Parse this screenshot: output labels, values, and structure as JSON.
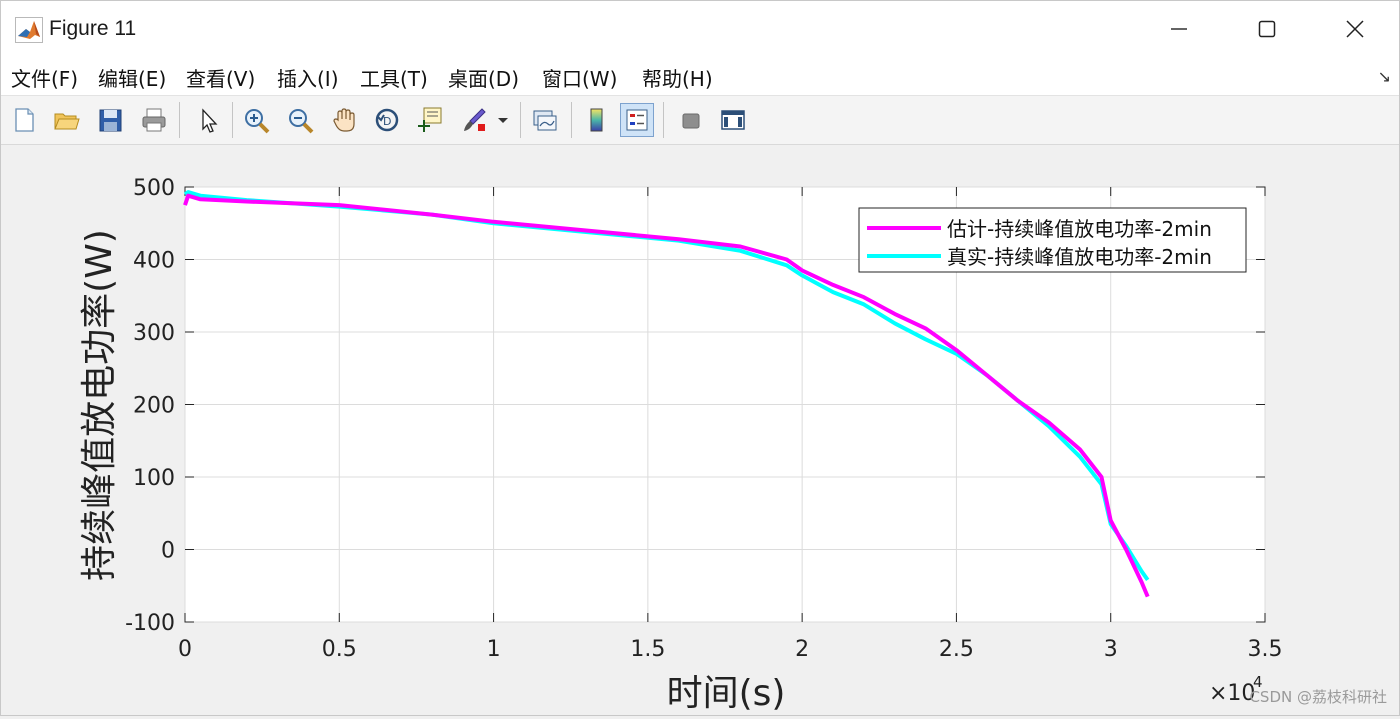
{
  "window": {
    "title": "Figure 11"
  },
  "menu": {
    "items": [
      "文件(F)",
      "编辑(E)",
      "查看(V)",
      "插入(I)",
      "工具(T)",
      "桌面(D)",
      "窗口(W)",
      "帮助(H)"
    ]
  },
  "toolbar": {
    "icons": [
      "new-figure-icon",
      "open-file-icon",
      "save-icon",
      "print-icon",
      "select-pointer-icon",
      "zoom-in-icon",
      "zoom-out-icon",
      "pan-hand-icon",
      "rotate-3d-icon",
      "data-cursor-icon",
      "brush-icon",
      "brush-dropdown-icon",
      "link-plot-icon",
      "colorbar-icon",
      "legend-icon",
      "hide-plot-tools-icon",
      "show-plot-tools-icon"
    ]
  },
  "chart_data": {
    "type": "line",
    "title": "",
    "xlabel": "时间(s)",
    "ylabel": "持续峰值放电功率(W)",
    "xlim": [
      0,
      3.5
    ],
    "ylim": [
      -100,
      500
    ],
    "x_exponent_label": "×10",
    "x_exponent_power": "4",
    "xticks": [
      "0",
      "0.5",
      "1",
      "1.5",
      "2",
      "2.5",
      "3",
      "3.5"
    ],
    "yticks": [
      "-100",
      "0",
      "100",
      "200",
      "300",
      "400",
      "500"
    ],
    "grid": true,
    "legend_position": "top-right",
    "series": [
      {
        "name": "估计-持续峰值放电功率-2min",
        "color": "#ff00ff",
        "x": [
          0,
          0.01,
          0.05,
          0.2,
          0.5,
          0.8,
          1.0,
          1.3,
          1.6,
          1.8,
          1.95,
          2.0,
          2.1,
          2.2,
          2.3,
          2.4,
          2.5,
          2.6,
          2.7,
          2.8,
          2.9,
          2.97,
          3.0,
          3.05,
          3.1,
          3.12
        ],
        "y": [
          475,
          488,
          483,
          480,
          475,
          462,
          452,
          440,
          428,
          418,
          400,
          385,
          365,
          348,
          325,
          305,
          275,
          240,
          205,
          175,
          138,
          100,
          40,
          0,
          -45,
          -65
        ]
      },
      {
        "name": "真实-持续峰值放电功率-2min",
        "color": "#00ffff",
        "x": [
          0,
          0.01,
          0.05,
          0.2,
          0.5,
          0.8,
          1.0,
          1.3,
          1.6,
          1.8,
          1.95,
          2.0,
          2.1,
          2.2,
          2.3,
          2.4,
          2.5,
          2.6,
          2.7,
          2.8,
          2.9,
          2.97,
          3.0,
          3.05,
          3.1,
          3.12
        ],
        "y": [
          490,
          493,
          488,
          482,
          473,
          462,
          450,
          438,
          426,
          412,
          392,
          378,
          355,
          338,
          312,
          290,
          270,
          240,
          205,
          170,
          128,
          90,
          35,
          5,
          -30,
          -42
        ]
      }
    ]
  },
  "watermark": "CSDN @荔枝科研社"
}
